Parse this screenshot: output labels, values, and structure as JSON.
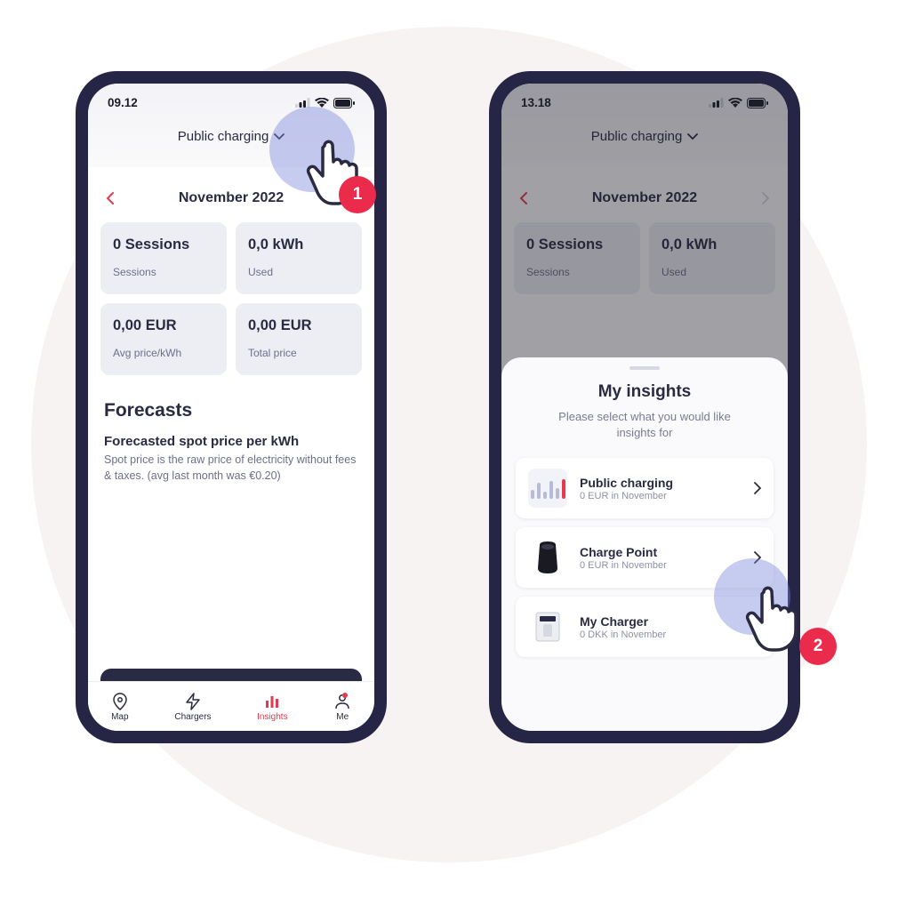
{
  "phone1": {
    "time": "09.12",
    "dropdown": "Public charging",
    "month": "November 2022",
    "cards": [
      {
        "value": "0 Sessions",
        "label": "Sessions"
      },
      {
        "value": "0,0 kWh",
        "label": "Used"
      },
      {
        "value": "0,00 EUR",
        "label": "Avg price/kWh"
      },
      {
        "value": "0,00 EUR",
        "label": "Total price"
      }
    ],
    "forecasts_heading": "Forecasts",
    "forecasts_title": "Forecasted spot price per kWh",
    "forecasts_body": "Spot price is the raw price of electricity without fees & taxes. (avg last month was €0.20)",
    "tabs": [
      {
        "label": "Map"
      },
      {
        "label": "Chargers"
      },
      {
        "label": "Insights"
      },
      {
        "label": "Me"
      }
    ],
    "badge": "1"
  },
  "phone2": {
    "time": "13.18",
    "dropdown": "Public charging",
    "month": "November 2022",
    "cards": [
      {
        "value": "0 Sessions",
        "label": "Sessions"
      },
      {
        "value": "0,0 kWh",
        "label": "Used"
      }
    ],
    "sheet": {
      "title": "My insights",
      "subtitle": "Please select what you would like insights for",
      "rows": [
        {
          "title": "Public charging",
          "subtitle": "0 EUR in November"
        },
        {
          "title": "Charge Point",
          "subtitle": "0 EUR in November"
        },
        {
          "title": "My Charger",
          "subtitle": "0 DKK in November"
        }
      ]
    },
    "badge": "2"
  }
}
